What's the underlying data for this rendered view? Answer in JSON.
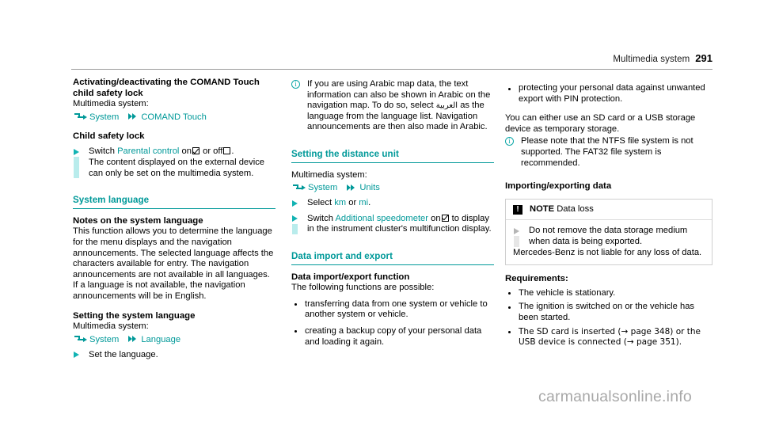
{
  "header": {
    "title": "Multimedia system",
    "page_number": "291"
  },
  "watermark": "carmanualsonline.info",
  "column1": {
    "heading": "Activating/deactivating the COMAND Touch child safety lock",
    "intro": "Multimedia system:",
    "crumb": {
      "item1": "System",
      "item2": "COMAND Touch"
    },
    "subheading": "Child safety lock",
    "step": {
      "line1_a": "Switch",
      "line1_link": "Parental control",
      "line1_b": "on",
      "line1_c": "or off",
      "line1_d": ".",
      "line2": "The content displayed on the external device can only be set on the multimedia system."
    },
    "section_language": "System language",
    "notes_heading": "Notes on the system language",
    "notes_body": "This function allows you to determine the language for the menu displays and the navigation announcements. The selected language affects the characters available for entry. The navigation announcements are not available in all languages. If a language is not available, the navigation announcements will be in English.",
    "setting_heading": "Setting the system language",
    "setting_intro": "Multimedia system:",
    "setting_crumb": {
      "item1": "System",
      "item2": "Language"
    },
    "setting_step": "Set the language."
  },
  "column2": {
    "info": {
      "part1": "If you are using Arabic map data, the text information can also be shown in Arabic on the navigation map. To do so, select",
      "arabic": "العربية",
      "part2": "as the language from the language list. Navigation announcements are then also made in Arabic."
    },
    "section_distance": "Setting the distance unit",
    "distance_intro": "Multimedia system:",
    "distance_crumb": {
      "item1": "System",
      "item2": "Units"
    },
    "step_select": {
      "a": "Select",
      "km": "km",
      "or": "or",
      "mi": "mi",
      "end": "."
    },
    "step_speedo": {
      "a": "Switch",
      "link": "Additional speedometer",
      "b": "on",
      "c": "to display in the instrument cluster's multifunction display."
    },
    "section_data": "Data import and export",
    "function_heading": "Data import/export function",
    "function_intro": "The following functions are possible:",
    "function_bullets": [
      "transferring data from one system or vehicle to another system or vehicle.",
      "creating a backup copy of your personal data and loading it again."
    ]
  },
  "column3": {
    "bullet_top": "protecting your personal data against unwanted export with PIN protection.",
    "storage_note": "You can either use an SD card or a USB storage device as temporary storage.",
    "info_ntfs": "Please note that the NTFS file system is not supported. The FAT32 file system is recommended.",
    "importing_heading": "Importing/exporting data",
    "note_box": {
      "icon_glyph": "!",
      "label": "NOTE",
      "subject": "Data loss",
      "step": "Do not remove the data storage medium when data is being exported.",
      "liability": "Mercedes-Benz is not liable for any loss of data."
    },
    "requirements_heading": "Requirements:",
    "requirements": [
      "The vehicle is stationary.",
      "The ignition is switched on or the vehicle has been started.",
      "The SD card is inserted (→ page 348) or the USB device is connected (→ page 351)."
    ]
  },
  "colors": {
    "accent_teal": "#009999",
    "accent_bar": "#b9ecec",
    "triangle": "#12b3b3",
    "rule_gray": "#9b9b9b",
    "watermark_gray": "#a8a8a8"
  }
}
